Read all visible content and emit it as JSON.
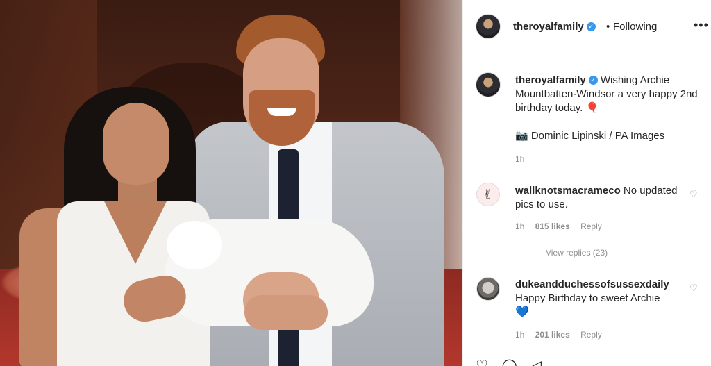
{
  "header": {
    "username": "theroyalfamily",
    "separator": "•",
    "follow_status": "Following",
    "more_label": "•••"
  },
  "caption": {
    "username": "theroyalfamily",
    "text": "Wishing Archie Mountbatten-Windsor a very happy 2nd birthday today. 🎈",
    "credit": "📷 Dominic Lipinski / PA Images",
    "time": "1h"
  },
  "comments": [
    {
      "username": "wallknotsmacrameco",
      "text": "No updated pics to use.",
      "time": "1h",
      "likes": "815 likes",
      "reply_label": "Reply",
      "view_replies": "View replies (23)",
      "avatar_glyph": "✌"
    },
    {
      "username": "dukeandduchessofsussexdaily",
      "text": "Happy Birthday to sweet Archie",
      "emoji": "💙",
      "time": "1h",
      "likes": "201 likes",
      "reply_label": "Reply"
    }
  ],
  "icons": {
    "verified": "✓",
    "heart": "♡",
    "comment": "◯",
    "share": "◁"
  },
  "colors": {
    "verified_blue": "#3897f0",
    "muted_text": "#8e8e8e",
    "primary_text": "#262626"
  }
}
